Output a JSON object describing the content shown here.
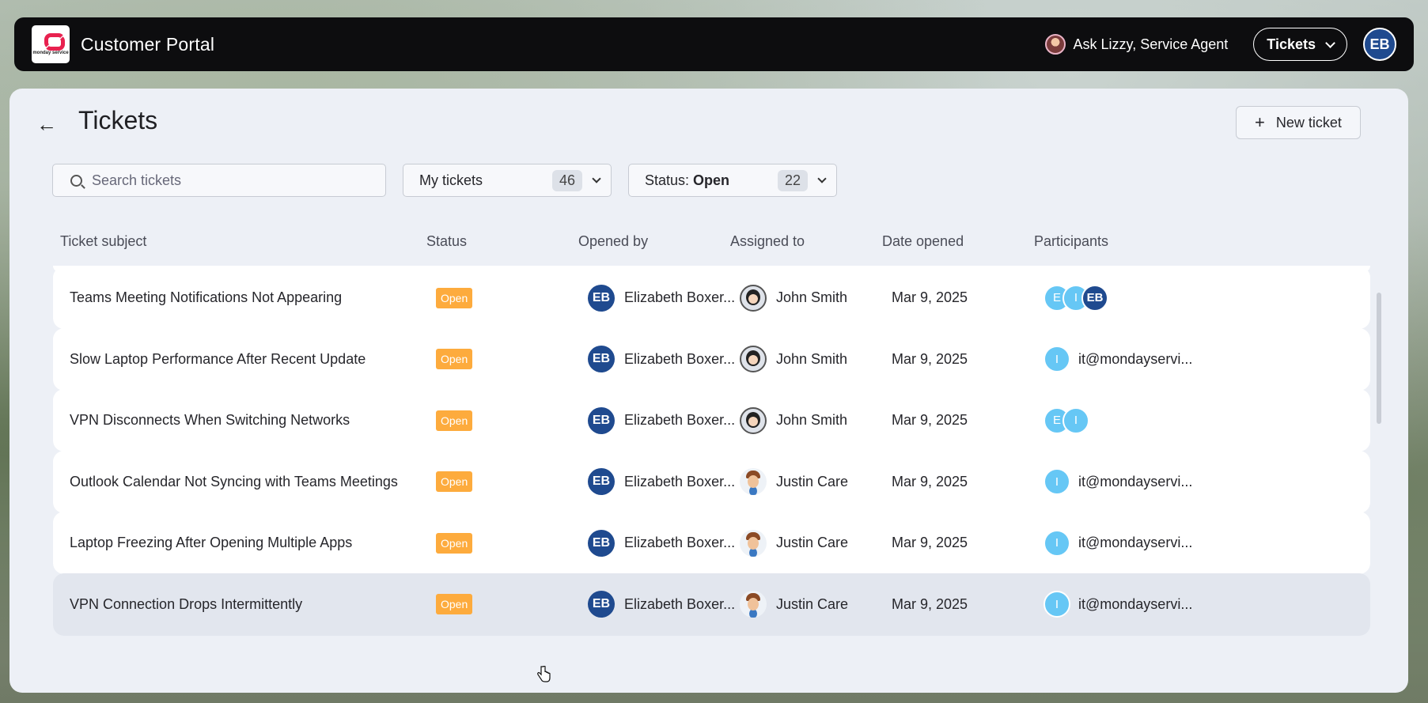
{
  "app": {
    "logo_text": "monday service",
    "title": "Customer Portal",
    "ask_agent": "Ask Lizzy, Service Agent",
    "nav_dropdown": "Tickets",
    "user_initials": "EB"
  },
  "page": {
    "title": "Tickets",
    "new_ticket_label": "New ticket"
  },
  "search": {
    "placeholder": "Search tickets",
    "value": ""
  },
  "filters": {
    "scope": {
      "label": "My tickets",
      "count": "46"
    },
    "status": {
      "prefix": "Status: ",
      "value": "Open",
      "count": "22"
    }
  },
  "columns": [
    "Ticket subject",
    "Status",
    "Opened by",
    "Assigned to",
    "Date opened",
    "Participants"
  ],
  "rows": [
    {
      "subject": "Teams Meeting Notifications Not Appearing",
      "status": "Open",
      "opened_by_initials": "EB",
      "opened_by": "Elizabeth Boxer...",
      "assigned_to": "John Smith",
      "assignee_avatar": "john",
      "date": "Mar 9, 2025",
      "participants": [
        "E",
        "I",
        "EB"
      ],
      "participant_email": ""
    },
    {
      "subject": "Slow Laptop Performance After Recent Update",
      "status": "Open",
      "opened_by_initials": "EB",
      "opened_by": "Elizabeth Boxer...",
      "assigned_to": "John Smith",
      "assignee_avatar": "john",
      "date": "Mar 9, 2025",
      "participants": [
        "I"
      ],
      "participant_email": "it@mondayservi..."
    },
    {
      "subject": "VPN Disconnects When Switching Networks",
      "status": "Open",
      "opened_by_initials": "EB",
      "opened_by": "Elizabeth Boxer...",
      "assigned_to": "John Smith",
      "assignee_avatar": "john",
      "date": "Mar 9, 2025",
      "participants": [
        "E",
        "I"
      ],
      "participant_email": ""
    },
    {
      "subject": "Outlook Calendar Not Syncing with Teams Meetings",
      "status": "Open",
      "opened_by_initials": "EB",
      "opened_by": "Elizabeth Boxer...",
      "assigned_to": "Justin Care",
      "assignee_avatar": "justin",
      "date": "Mar 9, 2025",
      "participants": [
        "I"
      ],
      "participant_email": "it@mondayservi..."
    },
    {
      "subject": "Laptop Freezing After Opening Multiple Apps",
      "status": "Open",
      "opened_by_initials": "EB",
      "opened_by": "Elizabeth Boxer...",
      "assigned_to": "Justin Care",
      "assignee_avatar": "justin",
      "date": "Mar 9, 2025",
      "participants": [
        "I"
      ],
      "participant_email": "it@mondayservi..."
    },
    {
      "subject": "VPN Connection Drops Intermittently",
      "status": "Open",
      "opened_by_initials": "EB",
      "opened_by": "Elizabeth Boxer...",
      "assigned_to": "Justin Care",
      "assignee_avatar": "justin",
      "date": "Mar 9, 2025",
      "participants": [
        "I"
      ],
      "participant_email": "it@mondayservi..."
    }
  ],
  "colors": {
    "status_open": "#fdab3d",
    "brand_red": "#e8214f",
    "avatar_blue": "#1f4a8f",
    "participant_light": "#66c7f5"
  }
}
